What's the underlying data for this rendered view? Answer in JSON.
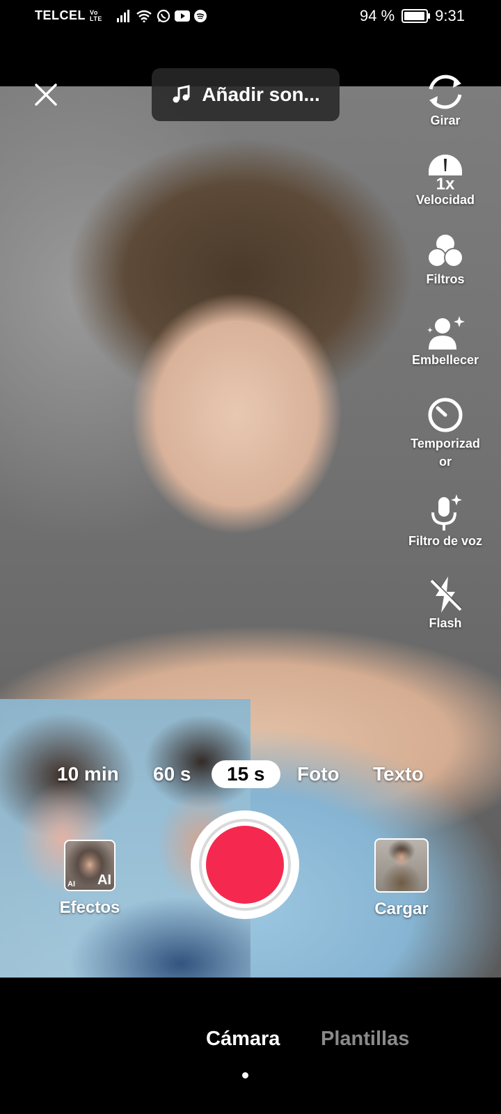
{
  "status_bar": {
    "carrier": "TELCEL",
    "volte_top": "Vo",
    "volte_bottom": "LTE",
    "battery": "94 %",
    "time": "9:31",
    "icons": [
      "signal-icon",
      "wifi-icon",
      "whatsapp-icon",
      "youtube-icon",
      "spotify-icon",
      "battery-icon"
    ]
  },
  "top": {
    "sound_label": "Añadir son..."
  },
  "side_tools": [
    {
      "name": "rotate",
      "label": "Girar"
    },
    {
      "name": "speed",
      "label": "Velocidad",
      "badge": "1x"
    },
    {
      "name": "filters",
      "label": "Filtros"
    },
    {
      "name": "beautify",
      "label": "Embellecer"
    },
    {
      "name": "timer",
      "label_line1": "Temporizad",
      "label_line2": "or"
    },
    {
      "name": "voice-filter",
      "label": "Filtro de voz"
    },
    {
      "name": "flash",
      "label": "Flash"
    }
  ],
  "modes": [
    {
      "label": "10 min",
      "active": false
    },
    {
      "label": "60 s",
      "active": false
    },
    {
      "label": "15 s",
      "active": true
    },
    {
      "label": "Foto",
      "active": false
    },
    {
      "label": "Texto",
      "active": false
    }
  ],
  "effects": {
    "label": "Efectos",
    "badge": "AI",
    "badge_small": "AI"
  },
  "upload": {
    "label": "Cargar"
  },
  "bottom_tabs": [
    {
      "label": "Cámara",
      "active": true
    },
    {
      "label": "Plantillas",
      "active": false
    }
  ],
  "colors": {
    "record": "#f5294f",
    "inactive_tab": "#8a8a8a"
  }
}
